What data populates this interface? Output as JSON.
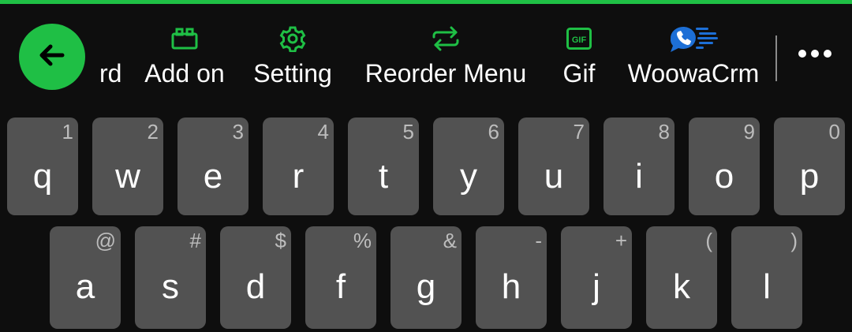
{
  "colors": {
    "accent": "#1fbf45",
    "background": "#0e0e0e",
    "key": "#525252",
    "hint": "#bdbdbd"
  },
  "toolbar": {
    "back_icon": "arrow-left-icon",
    "items": [
      {
        "label": "rd",
        "icon": ""
      },
      {
        "label": "Add on",
        "icon": "puzzle-block-icon"
      },
      {
        "label": "Setting",
        "icon": "gear-icon"
      },
      {
        "label": "Reorder Menu",
        "icon": "swap-arrows-icon"
      },
      {
        "label": "Gif",
        "icon": "gif-icon",
        "icon_text": "GIF"
      },
      {
        "label": "WoowaCrm",
        "icon": "chat-bubble-phone-icon"
      }
    ],
    "more_icon": "more-horizontal-icon"
  },
  "keyboard": {
    "row1": [
      {
        "char": "q",
        "hint": "1"
      },
      {
        "char": "w",
        "hint": "2"
      },
      {
        "char": "e",
        "hint": "3"
      },
      {
        "char": "r",
        "hint": "4"
      },
      {
        "char": "t",
        "hint": "5"
      },
      {
        "char": "y",
        "hint": "6"
      },
      {
        "char": "u",
        "hint": "7"
      },
      {
        "char": "i",
        "hint": "8"
      },
      {
        "char": "o",
        "hint": "9"
      },
      {
        "char": "p",
        "hint": "0"
      }
    ],
    "row2": [
      {
        "char": "a",
        "hint": "@"
      },
      {
        "char": "s",
        "hint": "#"
      },
      {
        "char": "d",
        "hint": "$"
      },
      {
        "char": "f",
        "hint": "%"
      },
      {
        "char": "g",
        "hint": "&"
      },
      {
        "char": "h",
        "hint": "-"
      },
      {
        "char": "j",
        "hint": "+"
      },
      {
        "char": "k",
        "hint": "("
      },
      {
        "char": "l",
        "hint": ")"
      }
    ]
  }
}
